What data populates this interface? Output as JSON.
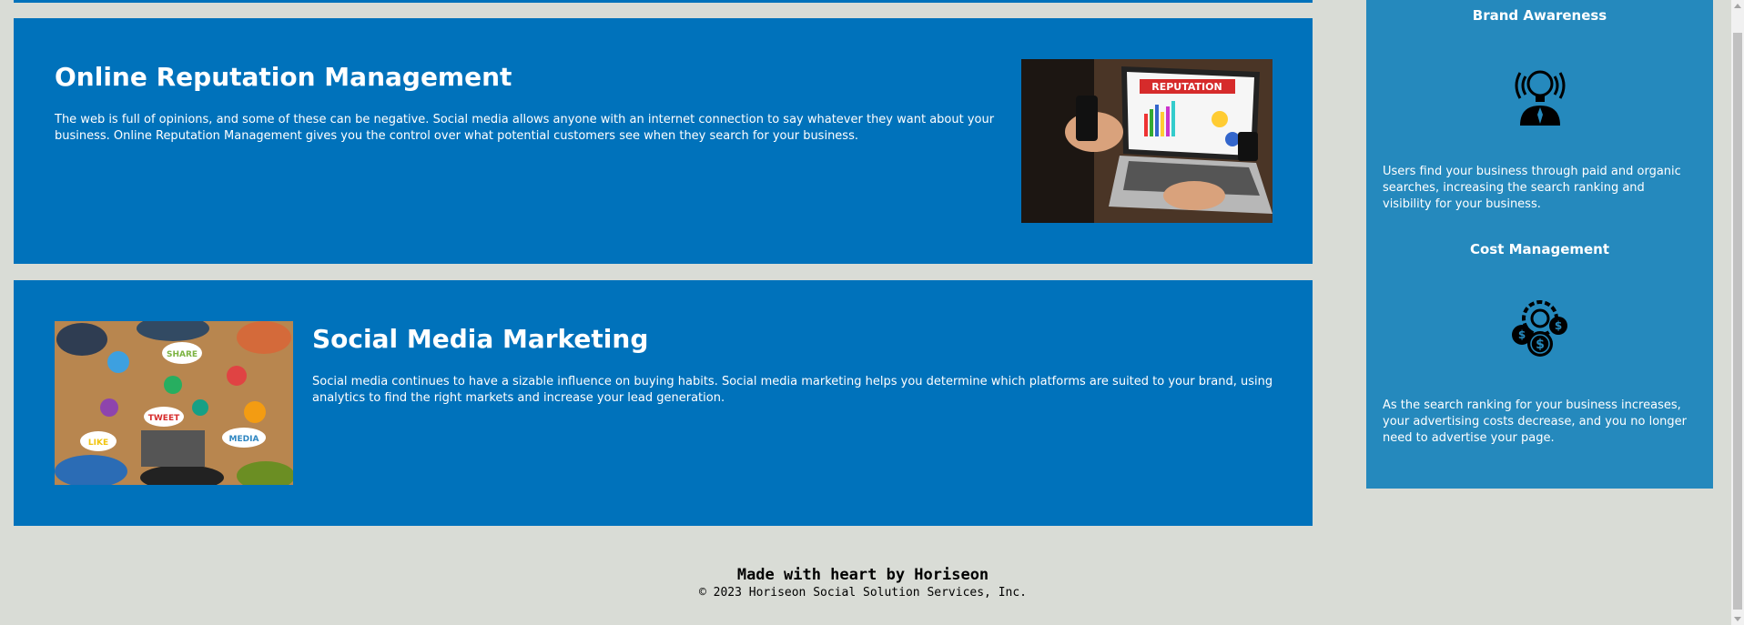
{
  "cards": {
    "orm": {
      "title": "Online Reputation Management",
      "text": "The web is full of opinions, and some of these can be negative. Social media allows anyone with an internet connection to say whatever they want about your business. Online Reputation Management gives you the control over what potential customers see when they search for your business.",
      "image_label": "REPUTATION"
    },
    "smm": {
      "title": "Social Media Marketing",
      "text": "Social media continues to have a sizable influence on buying habits. Social media marketing helps you determine which platforms are suited to your brand, using analytics to find the right markets and increase your lead generation.",
      "image_bubbles": [
        "SHARE",
        "TWEET",
        "LIKE",
        "MEDIA"
      ]
    }
  },
  "sidebar": {
    "brand": {
      "title": "Brand Awareness",
      "icon": "lightbulb-person-icon",
      "text": "Users find your business through paid and organic searches, increasing the search ranking and visibility for your business."
    },
    "cost": {
      "title": "Cost Management",
      "icon": "gear-dollar-icon",
      "text": "As the search ranking for your business increases, your advertising costs decrease, and you no longer need to advertise your page."
    }
  },
  "footer": {
    "heading": "Made with heart by Horiseon",
    "copyright": "© 2023 Horiseon Social Solution Services, Inc."
  },
  "colors": {
    "page_bg": "#d9dcd6",
    "card_bg": "#0072bb",
    "sidebar_bg": "#2589bd",
    "text_light": "#ffffff"
  }
}
